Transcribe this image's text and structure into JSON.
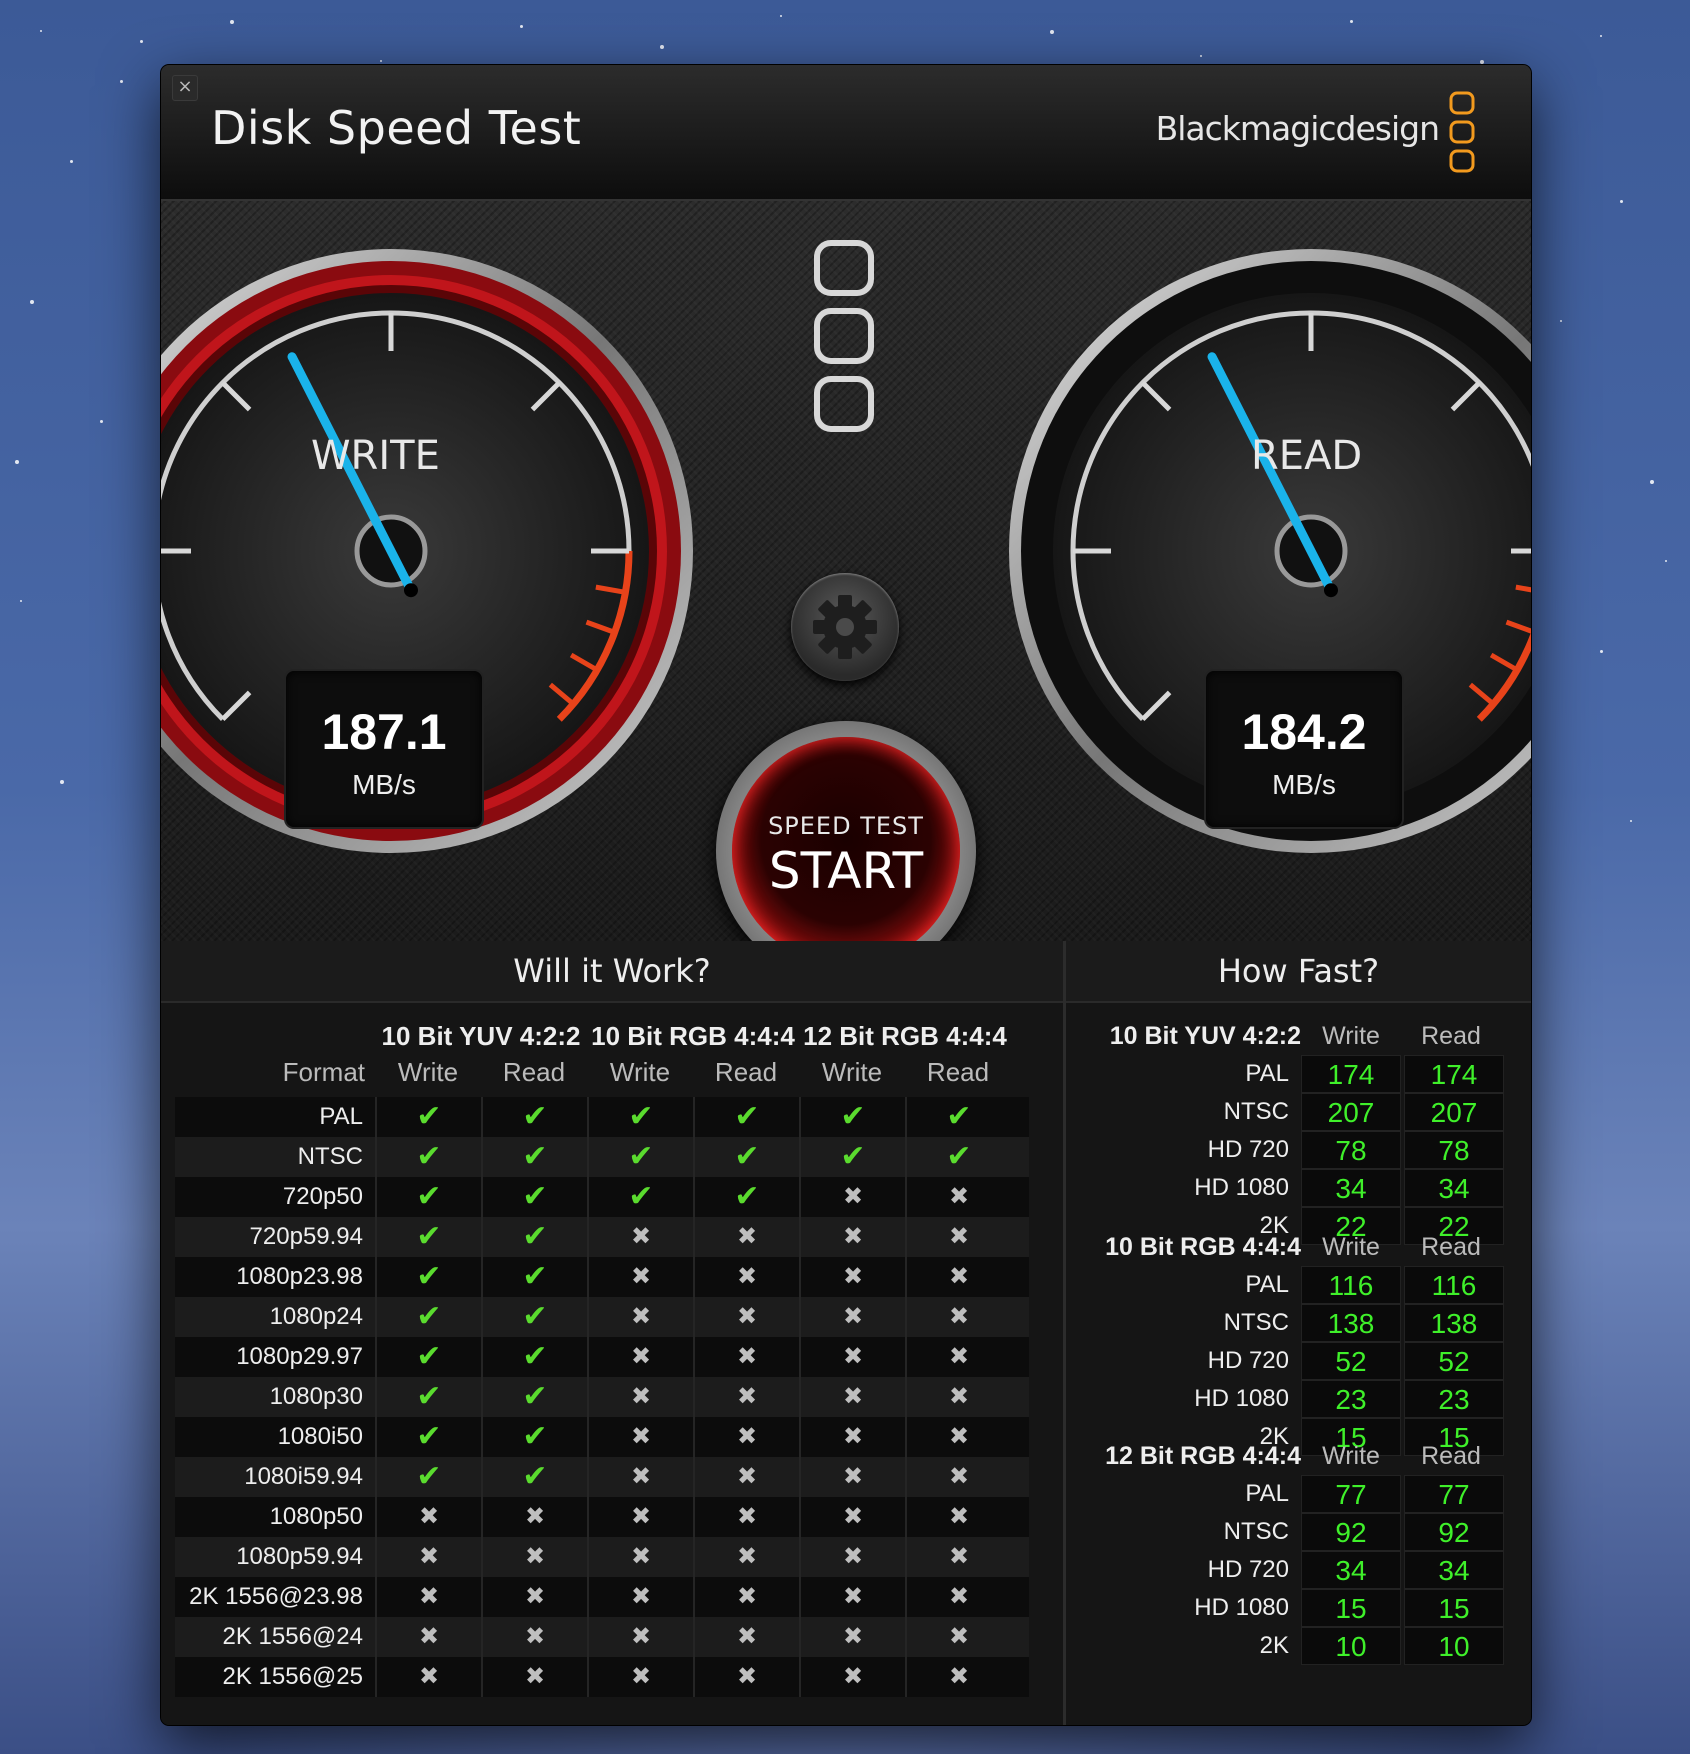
{
  "app": {
    "title": "Disk Speed Test",
    "brand": "Blackmagicdesign",
    "close": "×"
  },
  "gauges": {
    "write": {
      "label": "WRITE",
      "value": "187.1",
      "unit": "MB/s"
    },
    "read": {
      "label": "READ",
      "value": "184.2",
      "unit": "MB/s"
    }
  },
  "start_button": {
    "top": "SPEED TEST",
    "main": "START"
  },
  "will_it_work": {
    "title": "Will it Work?",
    "format_header": "Format",
    "groups": [
      "10 Bit YUV 4:2:2",
      "10 Bit RGB 4:4:4",
      "12 Bit RGB 4:4:4"
    ],
    "columns": [
      "Write",
      "Read",
      "Write",
      "Read",
      "Write",
      "Read"
    ],
    "rows": [
      {
        "format": "PAL",
        "ok": [
          1,
          1,
          1,
          1,
          1,
          1
        ]
      },
      {
        "format": "NTSC",
        "ok": [
          1,
          1,
          1,
          1,
          1,
          1
        ]
      },
      {
        "format": "720p50",
        "ok": [
          1,
          1,
          1,
          1,
          0,
          0
        ]
      },
      {
        "format": "720p59.94",
        "ok": [
          1,
          1,
          0,
          0,
          0,
          0
        ]
      },
      {
        "format": "1080p23.98",
        "ok": [
          1,
          1,
          0,
          0,
          0,
          0
        ]
      },
      {
        "format": "1080p24",
        "ok": [
          1,
          1,
          0,
          0,
          0,
          0
        ]
      },
      {
        "format": "1080p29.97",
        "ok": [
          1,
          1,
          0,
          0,
          0,
          0
        ]
      },
      {
        "format": "1080p30",
        "ok": [
          1,
          1,
          0,
          0,
          0,
          0
        ]
      },
      {
        "format": "1080i50",
        "ok": [
          1,
          1,
          0,
          0,
          0,
          0
        ]
      },
      {
        "format": "1080i59.94",
        "ok": [
          1,
          1,
          0,
          0,
          0,
          0
        ]
      },
      {
        "format": "1080p50",
        "ok": [
          0,
          0,
          0,
          0,
          0,
          0
        ]
      },
      {
        "format": "1080p59.94",
        "ok": [
          0,
          0,
          0,
          0,
          0,
          0
        ]
      },
      {
        "format": "2K 1556@23.98",
        "ok": [
          0,
          0,
          0,
          0,
          0,
          0
        ]
      },
      {
        "format": "2K 1556@24",
        "ok": [
          0,
          0,
          0,
          0,
          0,
          0
        ]
      },
      {
        "format": "2K 1556@25",
        "ok": [
          0,
          0,
          0,
          0,
          0,
          0
        ]
      }
    ]
  },
  "how_fast": {
    "title": "How Fast?",
    "col_write": "Write",
    "col_read": "Read",
    "groups": [
      {
        "name": "10 Bit YUV 4:2:2",
        "rows": [
          {
            "label": "PAL",
            "write": "174",
            "read": "174"
          },
          {
            "label": "NTSC",
            "write": "207",
            "read": "207"
          },
          {
            "label": "HD 720",
            "write": "78",
            "read": "78"
          },
          {
            "label": "HD 1080",
            "write": "34",
            "read": "34"
          },
          {
            "label": "2K",
            "write": "22",
            "read": "22"
          }
        ]
      },
      {
        "name": "10 Bit RGB 4:4:4",
        "rows": [
          {
            "label": "PAL",
            "write": "116",
            "read": "116"
          },
          {
            "label": "NTSC",
            "write": "138",
            "read": "138"
          },
          {
            "label": "HD 720",
            "write": "52",
            "read": "52"
          },
          {
            "label": "HD 1080",
            "write": "23",
            "read": "23"
          },
          {
            "label": "2K",
            "write": "15",
            "read": "15"
          }
        ]
      },
      {
        "name": "12 Bit RGB 4:4:4",
        "rows": [
          {
            "label": "PAL",
            "write": "77",
            "read": "77"
          },
          {
            "label": "NTSC",
            "write": "92",
            "read": "92"
          },
          {
            "label": "HD 720",
            "write": "34",
            "read": "34"
          },
          {
            "label": "HD 1080",
            "write": "15",
            "read": "15"
          },
          {
            "label": "2K",
            "write": "10",
            "read": "10"
          }
        ]
      }
    ]
  },
  "colors": {
    "accent_orange": "#f29a1e",
    "needle": "#1ab3ea",
    "ok_green": "#5adb2e",
    "value_green": "#3ff02a",
    "start_red": "#b41212"
  },
  "icons": {
    "close": "close-icon",
    "settings": "gear-icon",
    "ok": "checkmark-icon",
    "no": "cross-icon"
  }
}
